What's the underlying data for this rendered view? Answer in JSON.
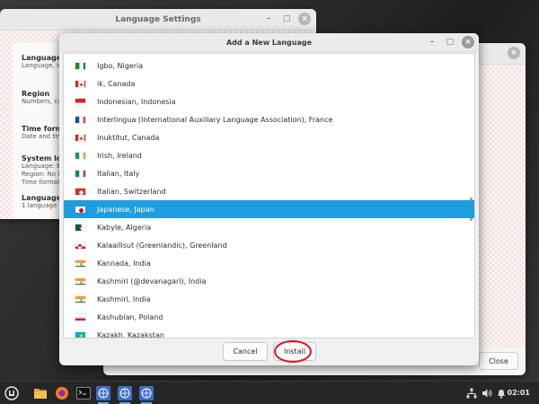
{
  "back_window": {
    "title": "Language Settings",
    "sections": [
      {
        "title": "Language",
        "sub": "Language, inte"
      },
      {
        "title": "Region",
        "sub": "Numbers, curr"
      },
      {
        "title": "Time forma",
        "sub": "Date and tim"
      },
      {
        "title": "System loca",
        "sub": "Language: Eng",
        "sub2": "Region: No lo",
        "sub3": "Time format:"
      },
      {
        "title": "Language s",
        "sub": "1 language ins"
      }
    ]
  },
  "right_window": {
    "close_label": "Close"
  },
  "dialog": {
    "title": "Add a New Language",
    "languages": [
      {
        "name": "Igbo, Nigeria",
        "flag": "ng",
        "selected": false
      },
      {
        "name": "ik, Canada",
        "flag": "ca",
        "selected": false
      },
      {
        "name": "Indonesian, Indonesia",
        "flag": "id",
        "selected": false
      },
      {
        "name": "Interlingua (International Auxiliary Language Association), France",
        "flag": "fr",
        "selected": false
      },
      {
        "name": "Inuktitut, Canada",
        "flag": "ca",
        "selected": false
      },
      {
        "name": "Irish, Ireland",
        "flag": "ie",
        "selected": false
      },
      {
        "name": "Italian, Italy",
        "flag": "it",
        "selected": false
      },
      {
        "name": "Italian, Switzerland",
        "flag": "ch",
        "selected": false
      },
      {
        "name": "Japanese, Japan",
        "flag": "jp",
        "selected": true
      },
      {
        "name": "Kabyle, Algeria",
        "flag": "dz",
        "selected": false
      },
      {
        "name": "Kalaallisut (Greenlandic), Greenland",
        "flag": "gl",
        "selected": false
      },
      {
        "name": "Kannada, India",
        "flag": "in",
        "selected": false
      },
      {
        "name": "Kashmiri (@devanagari), India",
        "flag": "in",
        "selected": false
      },
      {
        "name": "Kashmiri, India",
        "flag": "in",
        "selected": false
      },
      {
        "name": "Kashubian, Poland",
        "flag": "pl",
        "selected": false
      },
      {
        "name": "Kazakh, Kazakstan",
        "flag": "kz",
        "selected": false
      }
    ],
    "cancel_label": "Cancel",
    "install_label": "Install"
  },
  "taskbar": {
    "clock": "02:01",
    "items": [
      "menu-icon",
      "files-icon",
      "firefox-icon",
      "terminal-icon",
      "language-icon",
      "language-icon",
      "language-icon"
    ]
  },
  "colors": {
    "selection": "#1f9ede",
    "highlight_ring": "#e0141f"
  }
}
